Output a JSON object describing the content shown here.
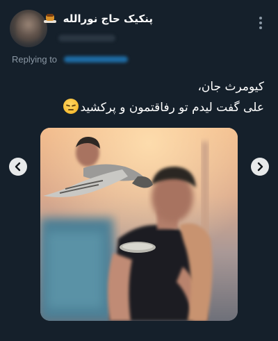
{
  "author": {
    "display_name": "پنکیک حاج نورالله",
    "name_emoji": "pancakes-emoji"
  },
  "reply": {
    "label": "Replying to"
  },
  "tweet": {
    "line1": "کیومرث جان،",
    "line2": "علی گفت لیدم تو رفاقتمون و پرکشید",
    "emoji": "pensive-face-emoji"
  },
  "media": {
    "description_icon": "photo",
    "prev_icon": "chevron-left-icon",
    "next_icon": "chevron-right-icon"
  },
  "colors": {
    "background": "#15202b",
    "text": "#ffffff",
    "muted": "#8b98a5",
    "link": "#1d9bf0"
  }
}
